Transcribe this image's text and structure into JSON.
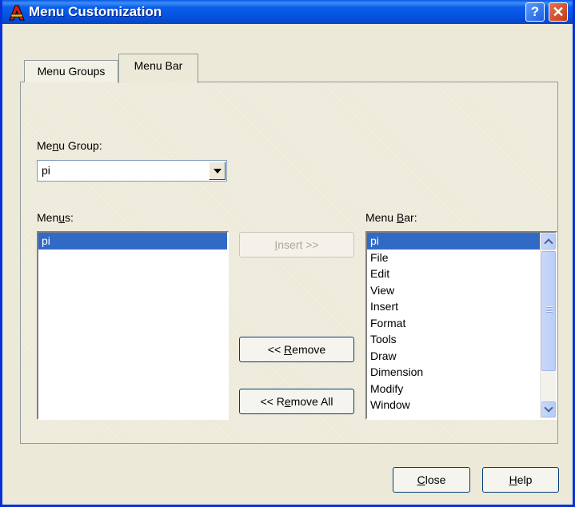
{
  "window": {
    "title": "Menu Customization",
    "help_button": "?",
    "close_button": "✕"
  },
  "tabs": [
    {
      "label": "Menu Groups",
      "selected": false
    },
    {
      "label": "Menu Bar",
      "selected": true
    }
  ],
  "menu_group": {
    "label_pre": "Me",
    "label_ul": "n",
    "label_post": "u Group:",
    "value": "pi"
  },
  "menus": {
    "label_pre": "Men",
    "label_ul": "u",
    "label_post": "s:",
    "items": [
      "pi"
    ],
    "selected": "pi"
  },
  "menu_bar": {
    "label_pre": "Menu ",
    "label_ul": "B",
    "label_post": "ar:",
    "items": [
      "pi",
      "File",
      "Edit",
      "View",
      "Insert",
      "Format",
      "Tools",
      "Draw",
      "Dimension",
      "Modify",
      "Window"
    ],
    "selected": "pi"
  },
  "buttons": {
    "insert": {
      "pre": "",
      "ul": "I",
      "post": "nsert >>",
      "enabled": false
    },
    "remove": {
      "pre": "<< ",
      "ul": "R",
      "post": "emove",
      "enabled": true
    },
    "remove_all": {
      "pre": "<< R",
      "ul": "e",
      "post": "move All",
      "enabled": true
    },
    "close": {
      "pre": "",
      "ul": "C",
      "post": "lose"
    },
    "help": {
      "pre": "",
      "ul": "H",
      "post": "elp"
    }
  }
}
